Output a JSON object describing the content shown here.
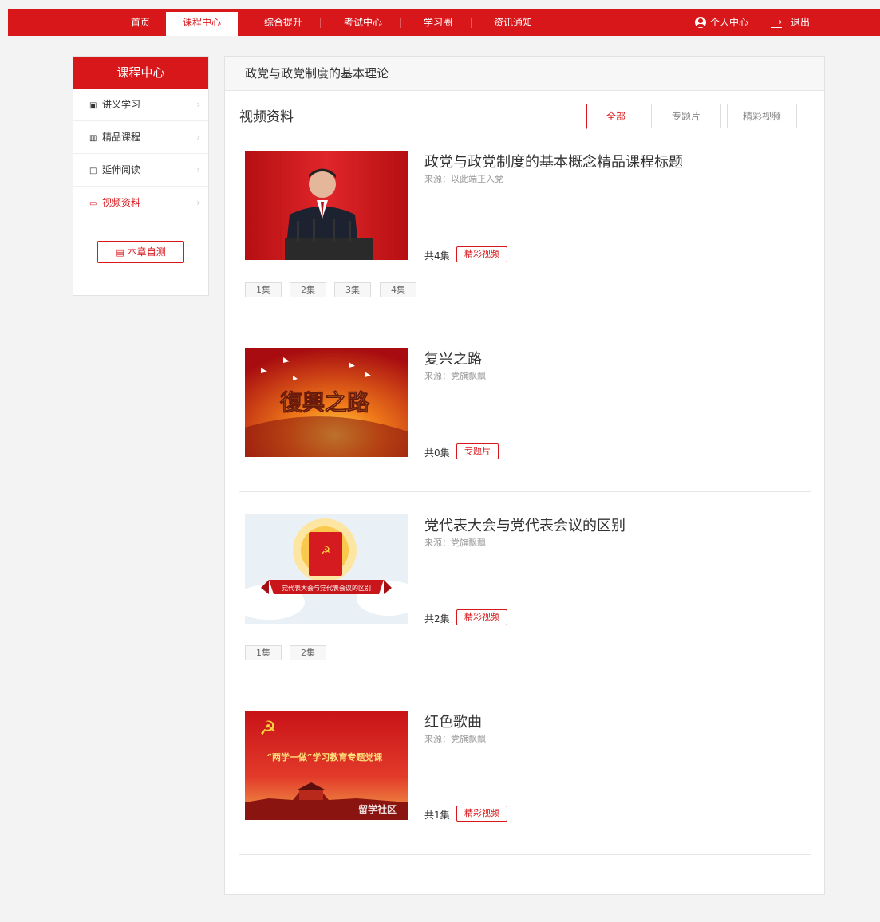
{
  "nav": {
    "items": [
      {
        "label": "首页"
      },
      {
        "label": "课程中心"
      },
      {
        "label": "综合提升"
      },
      {
        "label": "考试中心"
      },
      {
        "label": "学习圈"
      },
      {
        "label": "资讯通知"
      }
    ],
    "active_index": 1,
    "user_center": "个人中心",
    "logout": "退出"
  },
  "sidebar": {
    "title": "课程中心",
    "items": [
      {
        "label": "讲义学习",
        "icon": "document-icon"
      },
      {
        "label": "精品课程",
        "icon": "book-icon"
      },
      {
        "label": "延伸阅读",
        "icon": "bookmark-icon"
      },
      {
        "label": "视频资料",
        "icon": "video-icon"
      }
    ],
    "active_index": 3,
    "selftest_label": "本章自测"
  },
  "main": {
    "breadcrumb_title": "政党与政党制度的基本理论",
    "section_title": "视频资料",
    "tabs": [
      {
        "label": "全部"
      },
      {
        "label": "专题片"
      },
      {
        "label": "精彩视频"
      }
    ],
    "active_tab": 0,
    "entries": [
      {
        "title": "政党与政党制度的基本概念精品课程标题",
        "source": "来源：以此端正入党",
        "count": "共4集",
        "tag": "精彩视频",
        "episodes": [
          "1集",
          "2集",
          "3集",
          "4集"
        ],
        "thumb": "speaker-at-podium"
      },
      {
        "title": "复兴之路",
        "source": "来源：党旗飘飘",
        "count": "共0集",
        "tag": "专题片",
        "episodes": [],
        "thumb": "复興之路",
        "thumb_caption": "復興之路"
      },
      {
        "title": "党代表大会与党代表会议的区别",
        "source": "来源：党旗飘飘",
        "count": "共2集",
        "tag": "精彩视频",
        "episodes": [
          "1集",
          "2集"
        ],
        "thumb": "party-book-banner",
        "thumb_caption": "党代表大会与党代表会议的区别"
      },
      {
        "title": "红色歌曲",
        "source": "来源：党旗飘飘",
        "count": "共1集",
        "tag": "精彩视频",
        "episodes": [],
        "thumb": "red-flag-tiananmen",
        "thumb_caption": "“两学一做”学习教育专题党课",
        "thumb_watermark": "留学社区"
      }
    ]
  },
  "colors": {
    "brand_red": "#d8171b",
    "background": "#f3f3f3"
  }
}
